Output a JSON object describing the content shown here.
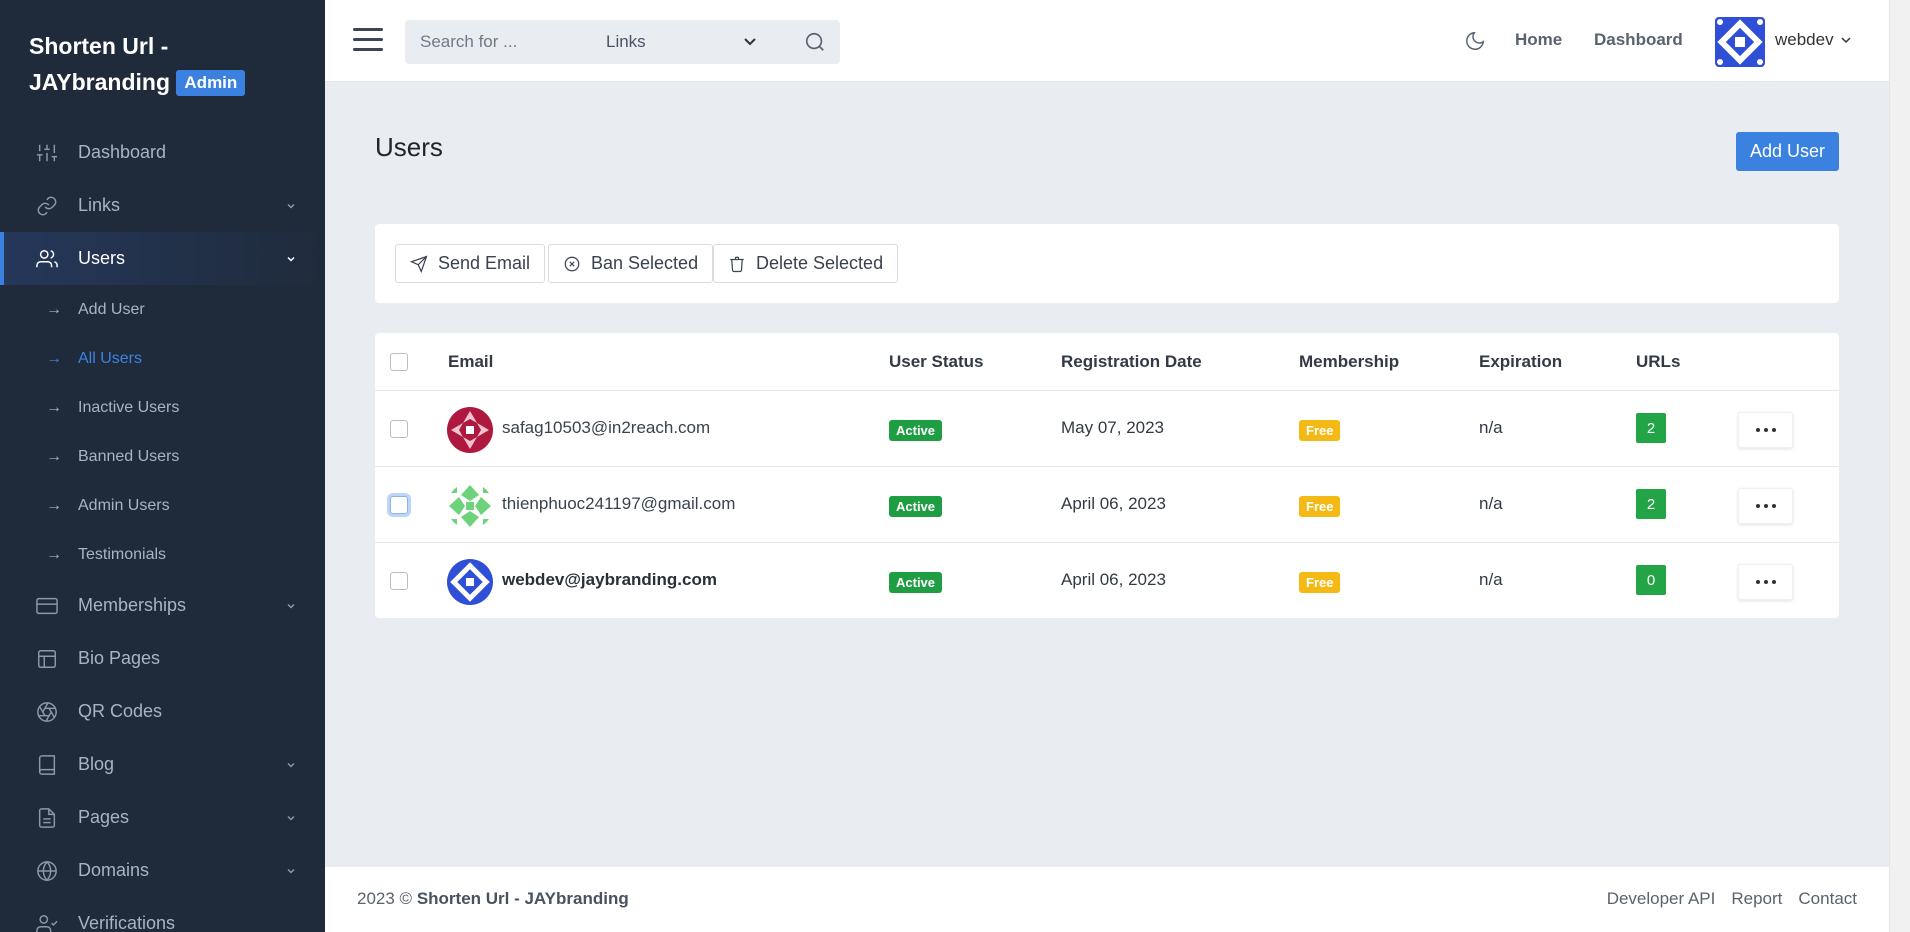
{
  "brand": {
    "title_line1": "Shorten Url -",
    "title_line2": "JAYbranding",
    "badge": "Admin"
  },
  "sidebar": {
    "items": [
      {
        "label": "Dashboard",
        "icon": "sliders-icon"
      },
      {
        "label": "Links",
        "icon": "link-icon",
        "has_chevron": true
      },
      {
        "label": "Users",
        "icon": "users-icon",
        "has_chevron": true,
        "active": true
      },
      {
        "label": "Memberships",
        "icon": "credit-card-icon",
        "has_chevron": true
      },
      {
        "label": "Bio Pages",
        "icon": "layout-icon"
      },
      {
        "label": "QR Codes",
        "icon": "aperture-icon"
      },
      {
        "label": "Blog",
        "icon": "book-icon",
        "has_chevron": true
      },
      {
        "label": "Pages",
        "icon": "file-text-icon",
        "has_chevron": true
      },
      {
        "label": "Domains",
        "icon": "globe-icon",
        "has_chevron": true
      },
      {
        "label": "Verifications",
        "icon": "user-check-icon"
      }
    ],
    "users_submenu": [
      {
        "label": "Add User"
      },
      {
        "label": "All Users",
        "active": true
      },
      {
        "label": "Inactive Users"
      },
      {
        "label": "Banned Users"
      },
      {
        "label": "Admin Users"
      },
      {
        "label": "Testimonials"
      }
    ],
    "submenu_arrow": "→"
  },
  "topbar": {
    "search_placeholder": "Search for ...",
    "search_scope": "Links",
    "home_link": "Home",
    "dashboard_link": "Dashboard",
    "username": "webdev"
  },
  "main": {
    "title": "Users",
    "add_user_label": "Add User",
    "actions": {
      "send_email": "Send Email",
      "ban_selected": "Ban Selected",
      "delete_selected": "Delete Selected"
    },
    "table": {
      "headers": {
        "email": "Email",
        "status": "User Status",
        "registration": "Registration Date",
        "membership": "Membership",
        "expiration": "Expiration",
        "urls": "URLs"
      },
      "rows": [
        {
          "email": "safag10503@in2reach.com",
          "status": "Active",
          "registration": "May 07, 2023",
          "membership": "Free",
          "expiration": "n/a",
          "urls": "2",
          "avatar_color": "#b0193f"
        },
        {
          "email": "thienphuoc241197@gmail.com",
          "status": "Active",
          "registration": "April 06, 2023",
          "membership": "Free",
          "expiration": "n/a",
          "urls": "2",
          "avatar_color": "#6cd37a"
        },
        {
          "email": "webdev@jaybranding.com",
          "status": "Active",
          "registration": "April 06, 2023",
          "membership": "Free",
          "expiration": "n/a",
          "urls": "0",
          "avatar_color": "#2f4fd6"
        }
      ]
    }
  },
  "footer": {
    "year": "2023 ©",
    "site_name": "Shorten Url - JAYbranding",
    "links": [
      "Developer API",
      "Report",
      "Contact"
    ]
  },
  "colors": {
    "sidebar_bg": "#1f2b3b",
    "accent": "#3b82e0",
    "active_badge": "#1f9d43",
    "free_badge": "#f5b915"
  }
}
